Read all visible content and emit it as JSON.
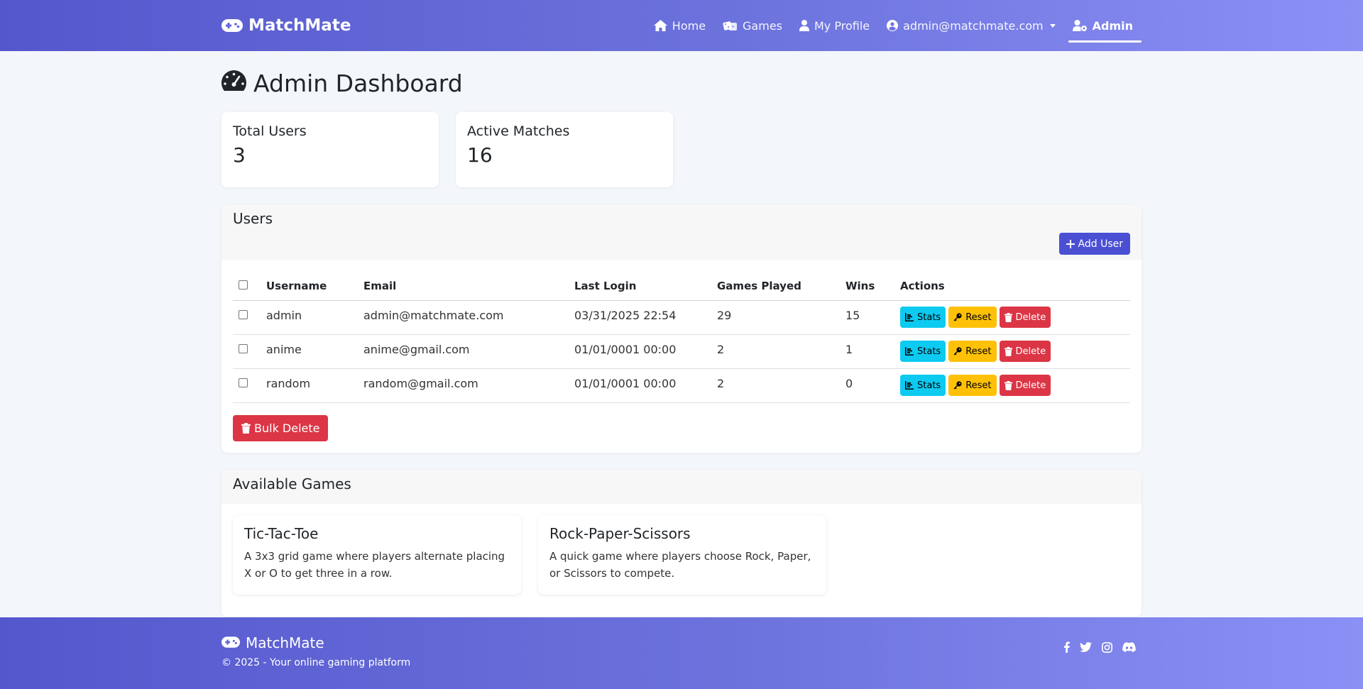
{
  "brand": {
    "name": "MatchMate"
  },
  "nav": {
    "items": [
      {
        "label": "Home",
        "icon": "home-icon"
      },
      {
        "label": "Games",
        "icon": "dice-icon"
      },
      {
        "label": "My Profile",
        "icon": "user-icon"
      },
      {
        "label": "admin@matchmate.com",
        "icon": "user-circle-icon"
      },
      {
        "label": "Admin",
        "icon": "user-cog-icon",
        "active": true
      }
    ]
  },
  "page": {
    "title": "Admin Dashboard"
  },
  "stats": [
    {
      "label": "Total Users",
      "value": "3"
    },
    {
      "label": "Active Matches",
      "value": "16"
    }
  ],
  "users": {
    "title": "Users",
    "add_label": "Add User",
    "columns": [
      "Username",
      "Email",
      "Last Login",
      "Games Played",
      "Wins",
      "Actions"
    ],
    "rows": [
      {
        "username": "admin",
        "email": "admin@matchmate.com",
        "last_login": "03/31/2025 22:54",
        "games_played": "29",
        "wins": "15"
      },
      {
        "username": "anime",
        "email": "anime@gmail.com",
        "last_login": "01/01/0001 00:00",
        "games_played": "2",
        "wins": "1"
      },
      {
        "username": "random",
        "email": "random@gmail.com",
        "last_login": "01/01/0001 00:00",
        "games_played": "2",
        "wins": "0"
      }
    ],
    "actions": {
      "stats": "Stats",
      "reset": "Reset",
      "delete": "Delete"
    },
    "bulk_delete_label": "Bulk Delete"
  },
  "games": {
    "title": "Available Games",
    "items": [
      {
        "title": "Tic-Tac-Toe",
        "description": "A 3x3 grid game where players alternate placing X or O to get three in a row."
      },
      {
        "title": "Rock-Paper-Scissors",
        "description": "A quick game where players choose Rock, Paper, or Scissors to compete."
      }
    ]
  },
  "footer": {
    "brand": "MatchMate",
    "copyright": "© 2025 - Your online gaming platform",
    "social": [
      "facebook-icon",
      "twitter-icon",
      "instagram-icon",
      "discord-icon"
    ]
  },
  "colors": {
    "primary": "#4a4fd4",
    "gradient_start": "#5457cc",
    "gradient_end": "#8a90f5",
    "info": "#0dcaf0",
    "warning": "#ffc107",
    "danger": "#dc3545"
  }
}
